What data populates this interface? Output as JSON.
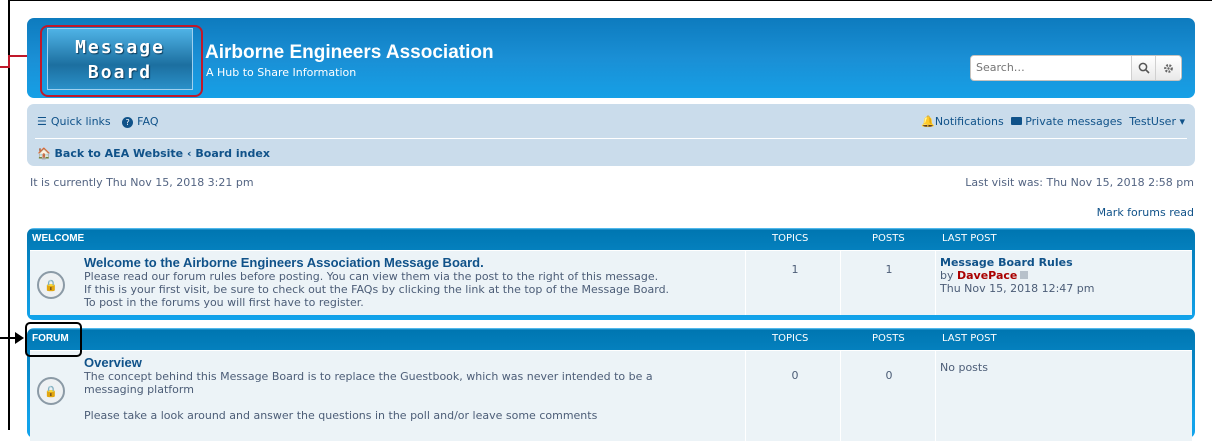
{
  "header": {
    "logo_line1": "Message",
    "logo_line2": "Board",
    "site_title": "Airborne Engineers Association",
    "site_desc": "A Hub to Share Information",
    "search_placeholder": "Search…",
    "search_icon": "search-icon",
    "advanced_search_icon": "gear-icon",
    "brand_color": "#0d7bbe"
  },
  "nav": {
    "quick_links": "Quick links",
    "faq": "FAQ",
    "notifications": "Notifications",
    "private_messages": "Private messages",
    "username": "TestUser",
    "crumb_back": "Back to AEA Website",
    "crumb_sep": "‹",
    "crumb_index": "Board index"
  },
  "status": {
    "current_time": "It is currently Thu Nov 15, 2018 3:21 pm",
    "last_visit": "Last visit was: Thu Nov 15, 2018 2:58 pm",
    "mark_read": "Mark forums read"
  },
  "columns": {
    "topics": "TOPICS",
    "posts": "POSTS",
    "last_post": "LAST POST"
  },
  "categories": [
    {
      "name": "WELCOME",
      "forum": {
        "title": "Welcome to the Airborne Engineers Association Message Board.",
        "desc_lines": [
          "Please read our forum rules before posting. You can view them via the post to the right of this message.",
          "If this is your first visit, be sure to check out the FAQs by clicking the link at the top of the Message Board.",
          "To post in the forums you will first have to register."
        ],
        "topics": "1",
        "posts": "1",
        "last_post_title": "Message Board Rules",
        "last_post_by": "by",
        "last_post_user": "DavePace",
        "last_post_time": "Thu Nov 15, 2018 12:47 pm"
      }
    },
    {
      "name": "FORUM",
      "forum": {
        "title": "Overview",
        "desc_lines": [
          "The concept behind this Message Board is to replace the Guestbook, which was never intended to be a",
          "messaging platform",
          "",
          "Please take a look around and answer the questions in the poll and/or leave some comments"
        ],
        "topics": "0",
        "posts": "0",
        "last_post_title": "No posts"
      }
    }
  ]
}
